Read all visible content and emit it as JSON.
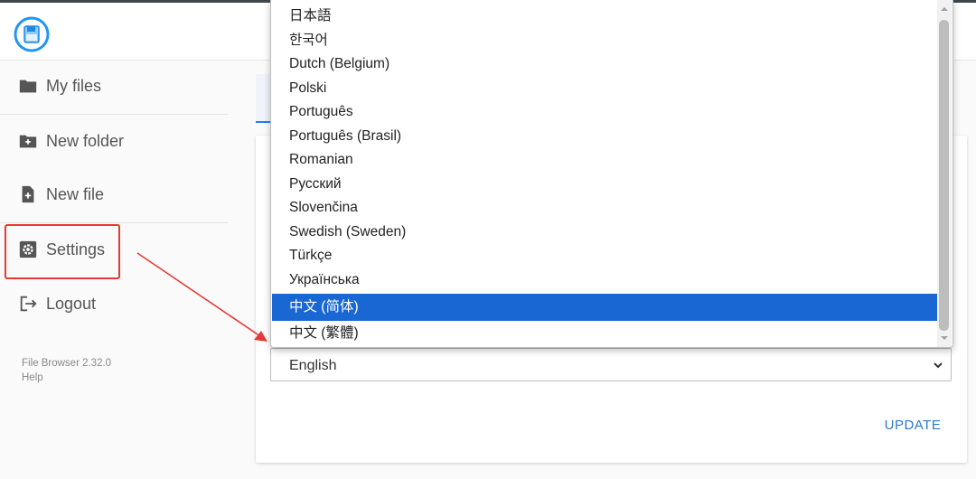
{
  "app": {
    "logo_icon": "floppy-disk-icon",
    "version": "File Browser 2.32.0",
    "help": "Help"
  },
  "sidebar": {
    "items": [
      {
        "label": "My files",
        "icon": "folder-icon"
      },
      {
        "label": "New folder",
        "icon": "new-folder-icon"
      },
      {
        "label": "New file",
        "icon": "new-file-icon"
      },
      {
        "label": "Settings",
        "icon": "settings-icon"
      },
      {
        "label": "Logout",
        "icon": "logout-icon"
      }
    ]
  },
  "language_select": {
    "selected": "English",
    "options": [
      {
        "label": "日本語"
      },
      {
        "label": "한국어"
      },
      {
        "label": "Dutch (Belgium)"
      },
      {
        "label": "Polski"
      },
      {
        "label": "Português"
      },
      {
        "label": "Português (Brasil)"
      },
      {
        "label": "Romanian"
      },
      {
        "label": "Русский"
      },
      {
        "label": "Slovenčina"
      },
      {
        "label": "Swedish (Sweden)"
      },
      {
        "label": "Türkçe"
      },
      {
        "label": "Українська"
      },
      {
        "label": "中文 (简体)",
        "highlighted": true
      },
      {
        "label": "中文 (繁體)"
      }
    ]
  },
  "actions": {
    "update_label": "UPDATE"
  },
  "colors": {
    "accent": "#1967d2",
    "link": "#2979c9",
    "annotation": "#e53935"
  }
}
